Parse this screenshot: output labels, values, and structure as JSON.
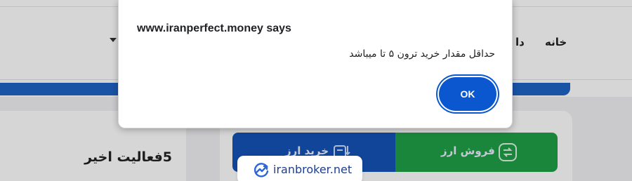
{
  "nav": {
    "home_label": "خانه",
    "partial_label": "دا"
  },
  "page": {
    "activity_title": "5فعالیت اخیر",
    "tabs": [
      {
        "label": "خرید ارز",
        "icon": "buy-transfer-icon",
        "color": "#1553b8"
      },
      {
        "label": "فروش ارز",
        "icon": "sell-exchange-icon",
        "color": "#1fa047"
      }
    ],
    "accent_color": "#1e63c6"
  },
  "dialog": {
    "title": "www.iranperfect.money says",
    "message": "حداقل مقدار خرید ترون ۵ تا میباشد",
    "ok_label": "OK",
    "button_color": "#0b57d0"
  },
  "watermark": {
    "text": "iranbroker.net",
    "icon": "trend-chart-icon"
  }
}
